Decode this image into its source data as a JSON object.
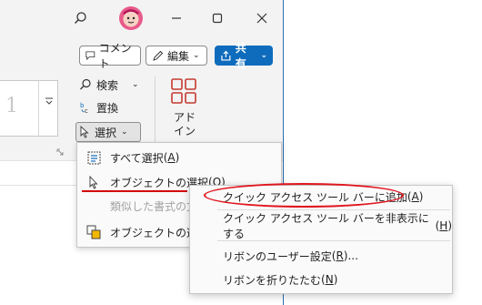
{
  "titlebar": {
    "search_icon": "search-icon",
    "avatar_icon": "avatar",
    "minimize_icon": "minimize-icon",
    "maximize_icon": "maximize-icon",
    "close_icon": "close-icon"
  },
  "toolbar": {
    "comment_label": "コメント",
    "edit_label": "編集",
    "share_label": "共有"
  },
  "ribbon": {
    "style_glyph": "1",
    "search_label": "検索",
    "replace_label": "置換",
    "select_label": "選択",
    "addins_line1": "アド",
    "addins_line2": "イン"
  },
  "select_menu": {
    "items": [
      {
        "label": "すべて選択",
        "key": "A",
        "enabled": true
      },
      {
        "label": "オブジェクトの選択",
        "key": "O",
        "enabled": true
      },
      {
        "label": "類似した書式の文",
        "enabled": false
      },
      {
        "label": "オブジェクトの選択",
        "enabled": true
      }
    ]
  },
  "context_menu": {
    "items": [
      {
        "label": "クイック アクセス ツール バーに追加",
        "key": "A"
      },
      {
        "label": "クイック アクセス ツール バーを非表示にする",
        "key": "H"
      },
      {
        "label": "リボンのユーザー設定",
        "key": "R",
        "suffix": "..."
      },
      {
        "label": "リボンを折りたたむ",
        "key": "N"
      }
    ]
  },
  "colors": {
    "accent": "#0f6cbd",
    "annotation_red": "#e0151e"
  }
}
